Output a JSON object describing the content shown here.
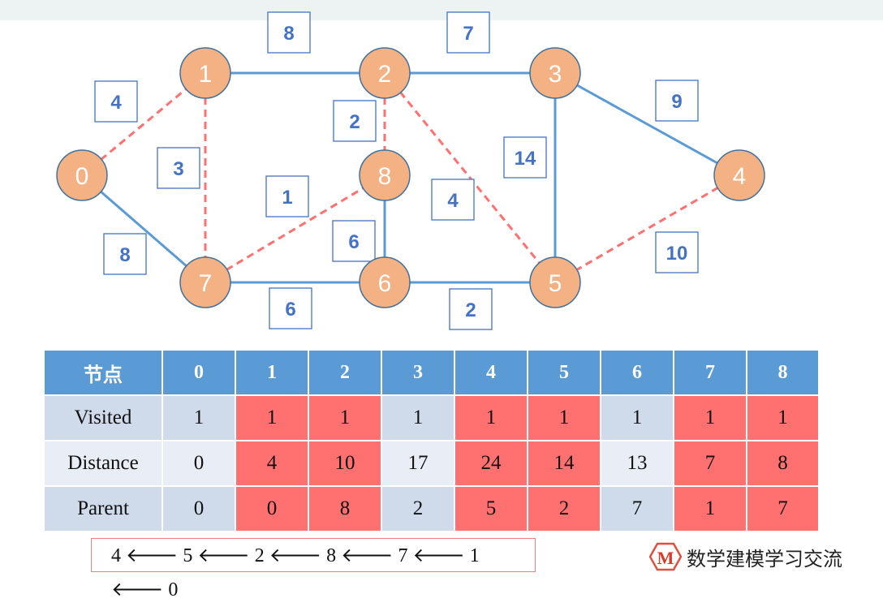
{
  "graph": {
    "nodes": [
      "0",
      "1",
      "2",
      "3",
      "4",
      "5",
      "6",
      "7",
      "8"
    ],
    "edges": [
      {
        "from": "1",
        "to": "2",
        "weight": "8",
        "highlighted": false
      },
      {
        "from": "2",
        "to": "3",
        "weight": "7",
        "highlighted": false
      },
      {
        "from": "0",
        "to": "1",
        "weight": "4",
        "highlighted": true
      },
      {
        "from": "1",
        "to": "7",
        "weight": "3",
        "highlighted": true
      },
      {
        "from": "2",
        "to": "8",
        "weight": "2",
        "highlighted": true
      },
      {
        "from": "3",
        "to": "5",
        "weight": "14",
        "highlighted": false
      },
      {
        "from": "3",
        "to": "4",
        "weight": "9",
        "highlighted": false
      },
      {
        "from": "7",
        "to": "8",
        "weight": "1",
        "highlighted": true
      },
      {
        "from": "2",
        "to": "5",
        "weight": "4",
        "highlighted": true
      },
      {
        "from": "8",
        "to": "6",
        "weight": "6",
        "highlighted": false
      },
      {
        "from": "0",
        "to": "7",
        "weight": "8",
        "highlighted": false
      },
      {
        "from": "4",
        "to": "5",
        "weight": "10",
        "highlighted": true
      },
      {
        "from": "7",
        "to": "6",
        "weight": "6",
        "highlighted": false
      },
      {
        "from": "6",
        "to": "5",
        "weight": "2",
        "highlighted": false
      }
    ],
    "colors": {
      "node": "#f4b183",
      "edge": "#5b9bd5",
      "highlight": "#ff7070",
      "label": "#4472c4"
    }
  },
  "table": {
    "header": [
      "节点",
      "0",
      "1",
      "2",
      "3",
      "4",
      "5",
      "6",
      "7",
      "8"
    ],
    "rows": [
      {
        "label": "Visited",
        "values": [
          "1",
          "1",
          "1",
          "1",
          "1",
          "1",
          "1",
          "1",
          "1"
        ]
      },
      {
        "label": "Distance",
        "values": [
          "0",
          "4",
          "10",
          "17",
          "24",
          "14",
          "13",
          "7",
          "8"
        ]
      },
      {
        "label": "Parent",
        "values": [
          "0",
          "0",
          "8",
          "2",
          "5",
          "2",
          "7",
          "1",
          "7"
        ]
      }
    ],
    "highlighted_columns": [
      "1",
      "2",
      "4",
      "5",
      "7",
      "8"
    ]
  },
  "path": "4 🡐 5 🡐 2 🡐 8 🡐 7 🡐 1 🡐 0",
  "logo": {
    "letter": "M",
    "text": "数学建模学习交流"
  }
}
